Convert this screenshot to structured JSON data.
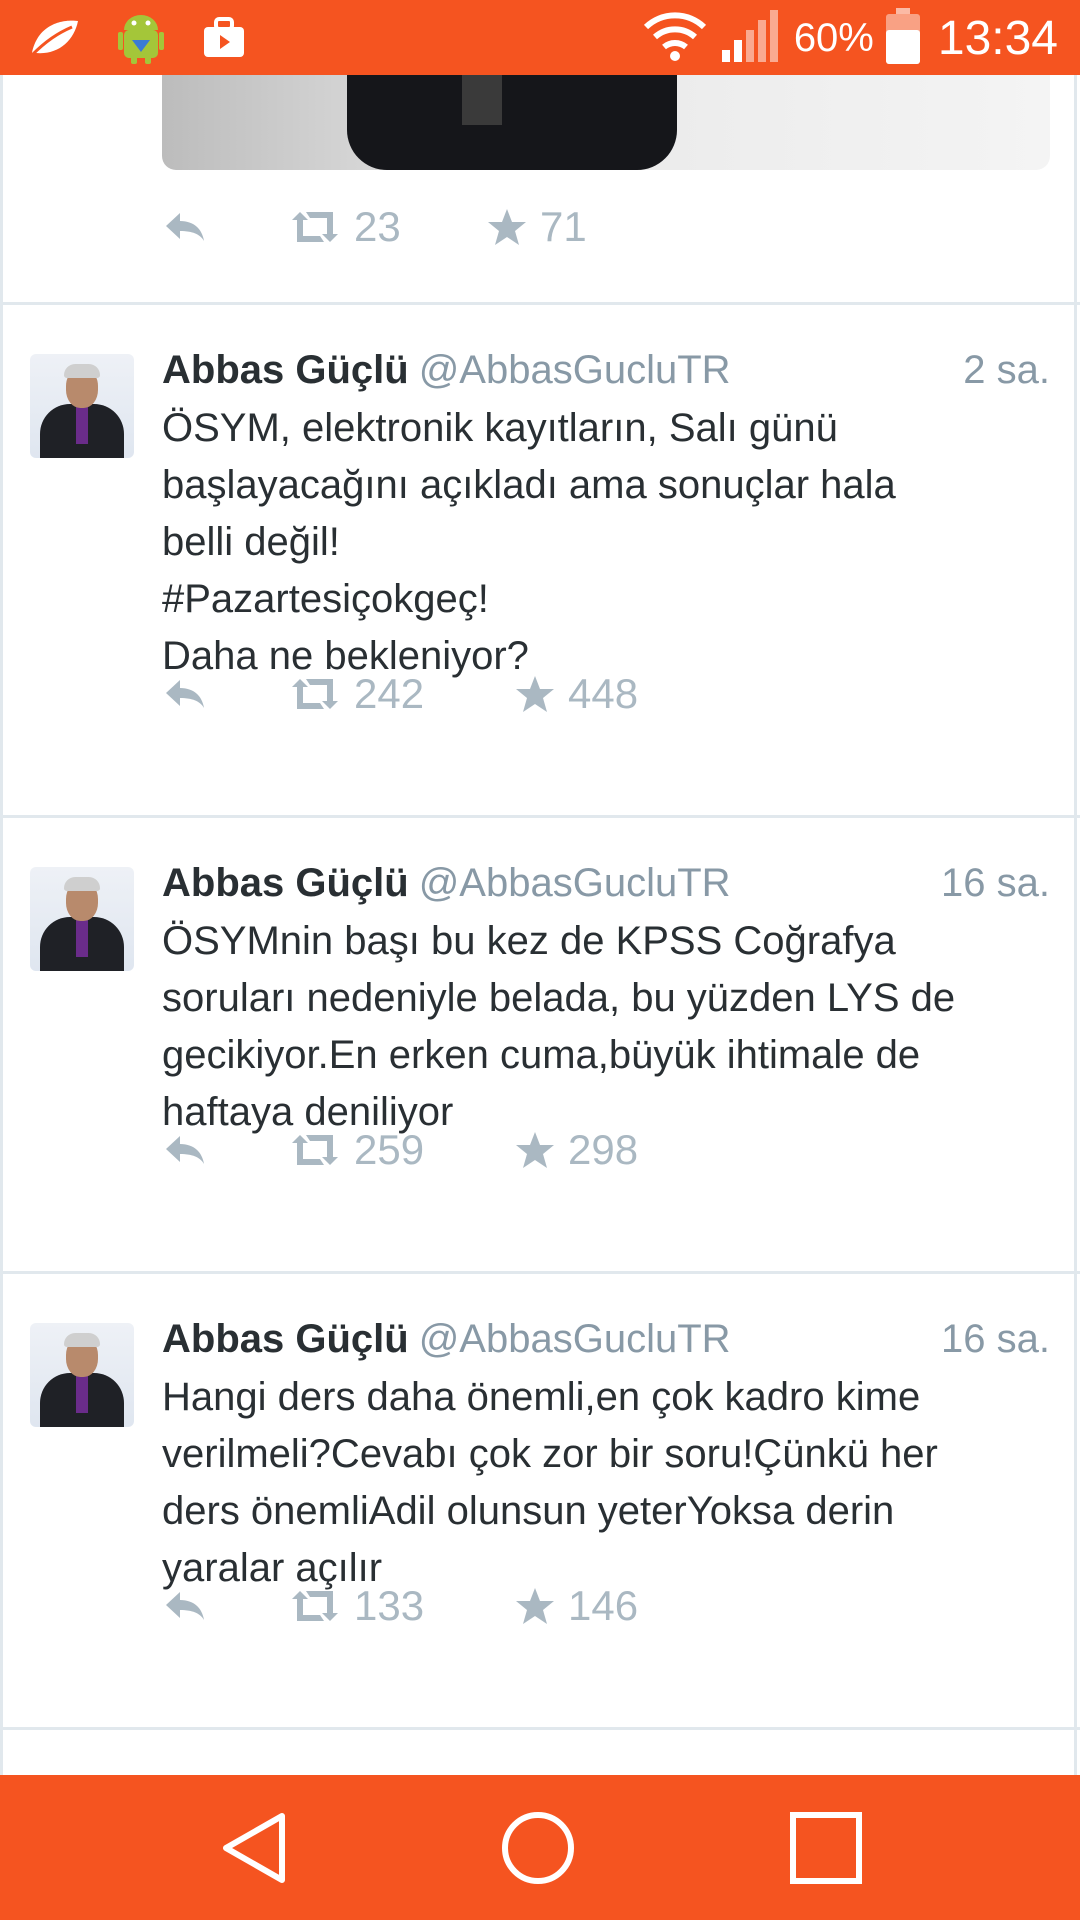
{
  "status_bar": {
    "battery_percent_label": "60%",
    "time": "13:34",
    "icons": [
      "leaf-notification-icon",
      "android-debug-icon",
      "briefcase-notification-icon",
      "wifi-icon",
      "signal-icon",
      "battery-icon"
    ]
  },
  "top_tweet": {
    "retweets": "23",
    "favorites": "71"
  },
  "tweets": [
    {
      "name": "Abbas Güçlü",
      "handle": "@AbbasGucluTR",
      "time": "2 sa.",
      "text": "ÖSYM, elektronik kayıtların, Salı günü\nbaşlayacağını açıkladı ama sonuçlar hala\nbelli değil!\n #Pazartesiçokgeç!\nDaha ne bekleniyor?",
      "retweets": "242",
      "favorites": "448"
    },
    {
      "name": "Abbas Güçlü",
      "handle": "@AbbasGucluTR",
      "time": "16 sa.",
      "text": "ÖSYMnin başı bu kez de KPSS Coğrafya\nsoruları nedeniyle belada, bu yüzden LYS de\ngecikiyor.En erken cuma,büyük ihtimale de\nhaftaya deniliyor",
      "retweets": "259",
      "favorites": "298"
    },
    {
      "name": "Abbas Güçlü",
      "handle": "@AbbasGucluTR",
      "time": "16 sa.",
      "text": "Hangi ders daha önemli,en çok kadro kime\nverilmeli?Cevabı çok zor bir soru!Çünkü her\nders önemliAdil olunsun yeterYoksa derin\nyaralar açılır",
      "retweets": "133",
      "favorites": "146"
    }
  ],
  "colors": {
    "accent": "#f55420",
    "icon_gray": "#aab8c2",
    "meta_gray": "#8899a6",
    "text": "#292f33",
    "divider": "#e1e8ed"
  }
}
